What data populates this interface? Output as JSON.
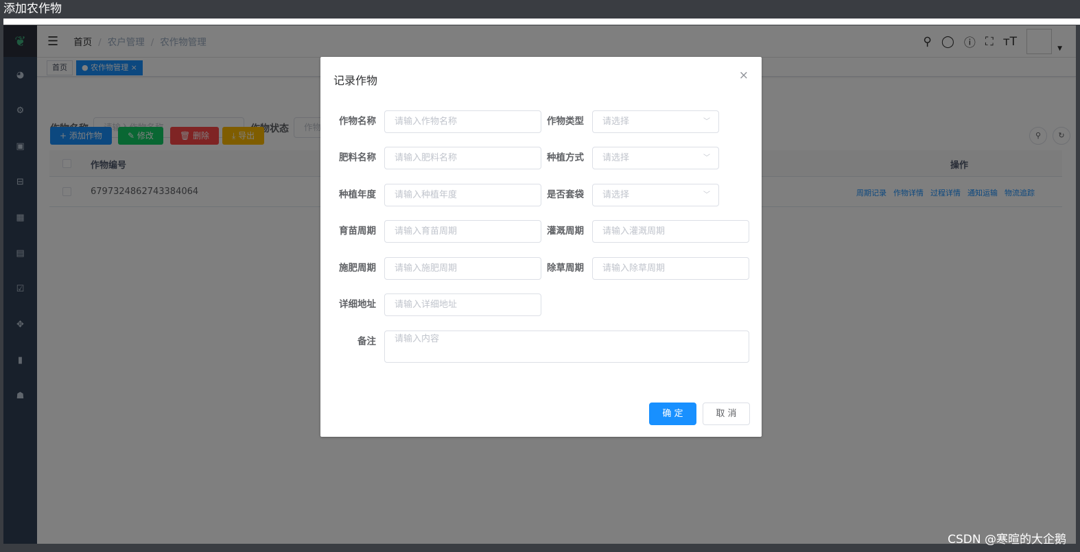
{
  "window": {
    "title": "添加农作物"
  },
  "header": {
    "breadcrumb": [
      "首页",
      "农户管理",
      "农作物管理"
    ],
    "separator": "/",
    "icons": [
      "search-icon",
      "github-icon",
      "question-icon",
      "fullscreen-icon",
      "font-size-icon"
    ]
  },
  "tags": {
    "home": "首页",
    "active": "农作物管理",
    "close": "×"
  },
  "search": {
    "name_label": "作物名称",
    "name_placeholder": "请输入作物名称",
    "status_label": "作物状态",
    "status_placeholder": "作物"
  },
  "toolbar": {
    "add": "+ 添加作物",
    "edit": "✎ 修改",
    "delete": "🗑 删除",
    "export": "⤓ 导出"
  },
  "table": {
    "columns": [
      "作物编号",
      "操作"
    ],
    "rows": [
      {
        "id": "6797324862743384064",
        "ops": [
          "周期记录",
          "作物详情",
          "过程详情",
          "通知运输",
          "物流追踪"
        ]
      }
    ]
  },
  "dialog": {
    "title": "记录作物",
    "close": "×",
    "fields": [
      {
        "label": "作物名称",
        "placeholder": "请输入作物名称"
      },
      {
        "label": "作物类型",
        "placeholder": "请选择"
      },
      {
        "label": "肥料名称",
        "placeholder": "请输入肥料名称"
      },
      {
        "label": "种植方式",
        "placeholder": "请选择"
      },
      {
        "label": "种植年度",
        "placeholder": "请输入种植年度"
      },
      {
        "label": "是否套袋",
        "placeholder": "请选择"
      },
      {
        "label": "育苗周期",
        "placeholder": "请输入育苗周期"
      },
      {
        "label": "灌溉周期",
        "placeholder": "请输入灌溉周期"
      },
      {
        "label": "施肥周期",
        "placeholder": "请输入施肥周期"
      },
      {
        "label": "除草周期",
        "placeholder": "请输入除草周期"
      },
      {
        "label": "详细地址",
        "placeholder": "请输入详细地址"
      },
      {
        "label": "备注",
        "placeholder": "请输入内容"
      }
    ],
    "confirm": "确 定",
    "cancel": "取 消"
  },
  "watermark": "CSDN @寒暄的大企鹅",
  "colors": {
    "primary": "#1890ff",
    "success": "#13ce66",
    "danger": "#ff4949",
    "warning": "#ffba00",
    "sidebar": "#304156"
  }
}
